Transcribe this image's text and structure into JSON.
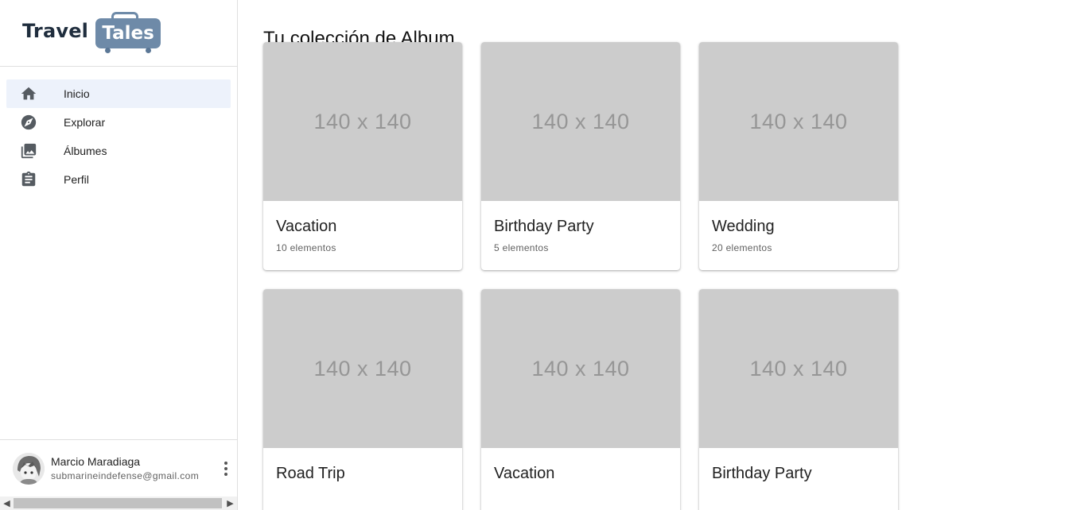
{
  "logo": {
    "word": "Travel",
    "badge": "Tales"
  },
  "nav": [
    {
      "label": "Inicio",
      "icon": "home-icon",
      "active": true
    },
    {
      "label": "Explorar",
      "icon": "compass-icon",
      "active": false
    },
    {
      "label": "Álbumes",
      "icon": "photo-library-icon",
      "active": false
    },
    {
      "label": "Perfil",
      "icon": "assignment-icon",
      "active": false
    }
  ],
  "user": {
    "name": "Marcio Maradiaga",
    "email": "submarineindefense@gmail.com"
  },
  "main": {
    "title": "Tu colección de Album",
    "albums": [
      {
        "placeholder": "140 x 140",
        "title": "Vacation",
        "count": "10 elementos"
      },
      {
        "placeholder": "140 x 140",
        "title": "Birthday Party",
        "count": "5 elementos"
      },
      {
        "placeholder": "140 x 140",
        "title": "Wedding",
        "count": "20 elementos"
      },
      {
        "placeholder": "140 x 140",
        "title": "Road Trip",
        "count": ""
      },
      {
        "placeholder": "140 x 140",
        "title": "Vacation",
        "count": ""
      },
      {
        "placeholder": "140 x 140",
        "title": "Birthday Party",
        "count": ""
      }
    ]
  },
  "colors": {
    "logo_badge": "#6e8aa8",
    "nav_active_bg": "#edf2fb",
    "placeholder_bg": "#cccccc"
  }
}
